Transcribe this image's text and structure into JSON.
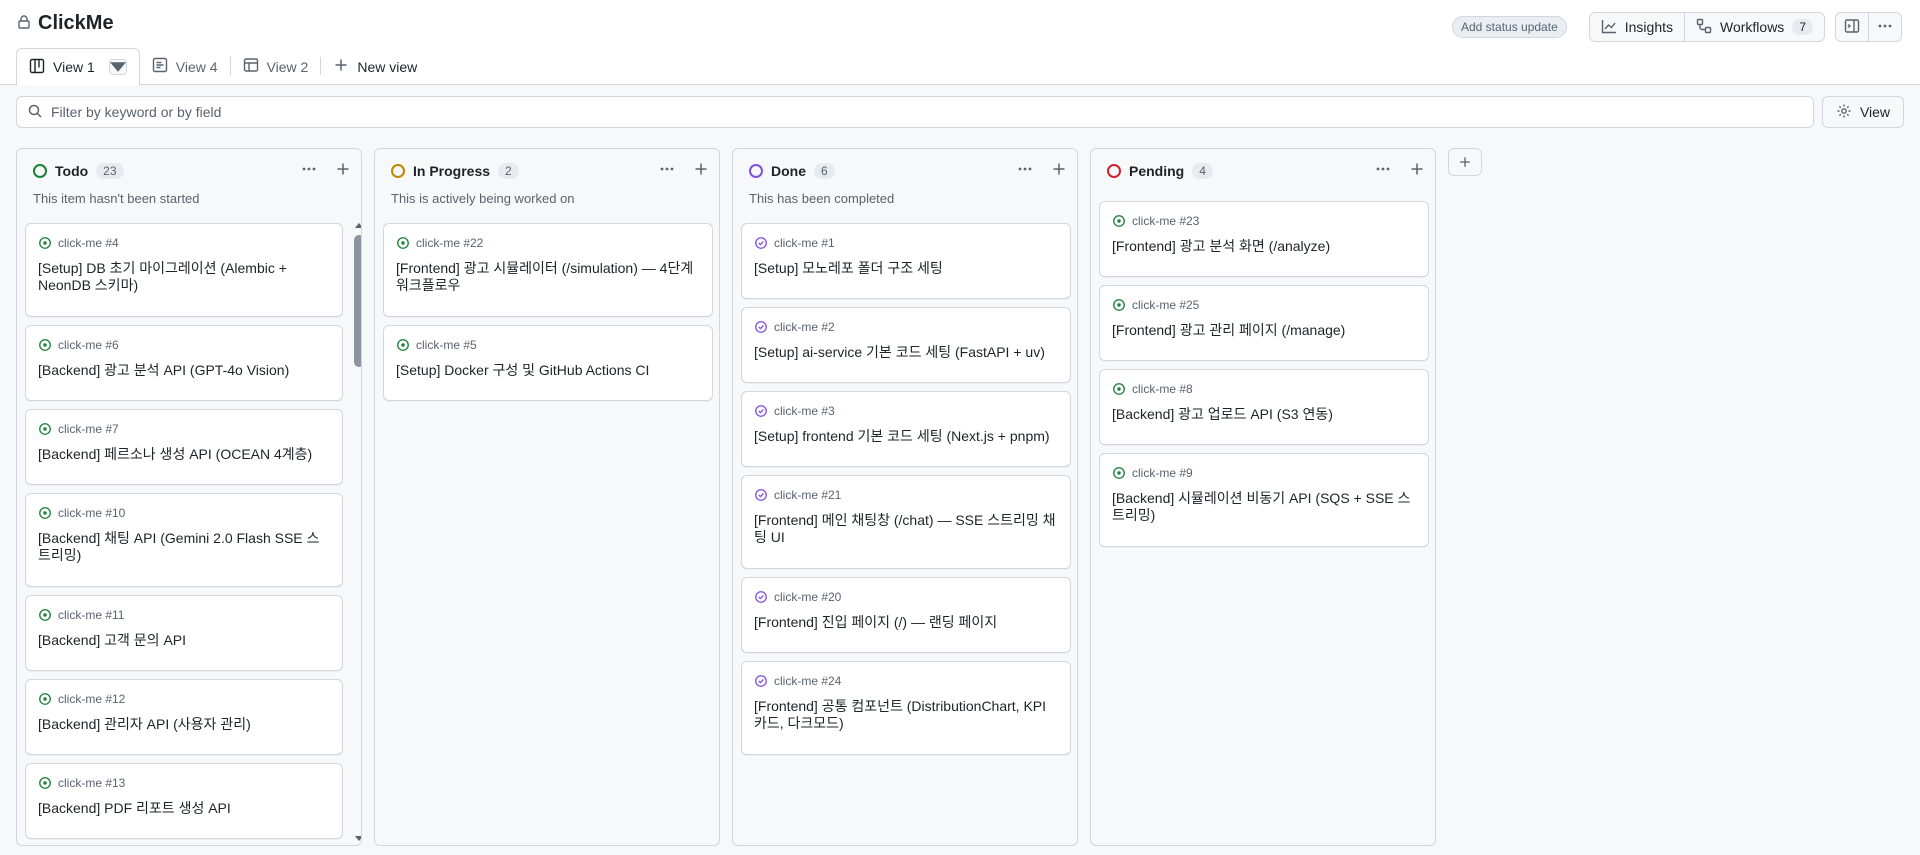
{
  "app": {
    "title": "ClickMe",
    "add_status_update": "Add status update",
    "insights_label": "Insights",
    "workflows_label": "Workflows",
    "workflows_count": "7"
  },
  "tabs": [
    {
      "label": "View 1",
      "icon": "board-icon",
      "active": true
    },
    {
      "label": "View 4",
      "icon": "roadmap-icon",
      "active": false
    },
    {
      "label": "View 2",
      "icon": "table-icon",
      "active": false
    },
    {
      "label": "New view",
      "icon": "plus-icon",
      "active": false
    }
  ],
  "filter": {
    "placeholder": "Filter by keyword or by field",
    "view_button_label": "View"
  },
  "colors": {
    "todo": "#1a7f37",
    "in_progress": "#bf8700",
    "done": "#8250df",
    "pending": "#cf222e"
  },
  "columns": [
    {
      "id": "todo",
      "title": "Todo",
      "count": "23",
      "description": "This item hasn't been started",
      "cards": [
        {
          "ref": "click-me #4",
          "title": "[Setup] DB 초기 마이그레이션 (Alembic + NeonDB 스키마)"
        },
        {
          "ref": "click-me #6",
          "title": "[Backend] 광고 분석 API (GPT-4o Vision)"
        },
        {
          "ref": "click-me #7",
          "title": "[Backend] 페르소나 생성 API (OCEAN 4계층)"
        },
        {
          "ref": "click-me #10",
          "title": "[Backend] 채팅 API (Gemini 2.0 Flash SSE 스트리밍)"
        },
        {
          "ref": "click-me #11",
          "title": "[Backend] 고객 문의 API"
        },
        {
          "ref": "click-me #12",
          "title": "[Backend] 관리자 API (사용자 관리)"
        },
        {
          "ref": "click-me #13",
          "title": "[Backend] PDF 리포트 생성 API"
        }
      ]
    },
    {
      "id": "in_progress",
      "title": "In Progress",
      "count": "2",
      "description": "This is actively being worked on",
      "cards": [
        {
          "ref": "click-me #22",
          "title": "[Frontend] 광고 시뮬레이터 (/simulation) — 4단계 워크플로우"
        },
        {
          "ref": "click-me #5",
          "title": "[Setup] Docker 구성 및 GitHub Actions CI"
        }
      ]
    },
    {
      "id": "done",
      "title": "Done",
      "count": "6",
      "description": "This has been completed",
      "cards": [
        {
          "ref": "click-me #1",
          "title": "[Setup] 모노레포 폴더 구조 세팅"
        },
        {
          "ref": "click-me #2",
          "title": "[Setup] ai-service 기본 코드 세팅 (FastAPI + uv)"
        },
        {
          "ref": "click-me #3",
          "title": "[Setup] frontend 기본 코드 세팅 (Next.js + pnpm)"
        },
        {
          "ref": "click-me #21",
          "title": "[Frontend] 메인 채팅창 (/chat) — SSE 스트리밍 채팅 UI"
        },
        {
          "ref": "click-me #20",
          "title": "[Frontend] 진입 페이지 (/) — 랜딩 페이지"
        },
        {
          "ref": "click-me #24",
          "title": "[Frontend] 공통 컴포넌트 (DistributionChart, KPI 카드, 다크모드)"
        }
      ]
    },
    {
      "id": "pending",
      "title": "Pending",
      "count": "4",
      "description": "",
      "cards": [
        {
          "ref": "click-me #23",
          "title": "[Frontend] 광고 분석 화면 (/analyze)"
        },
        {
          "ref": "click-me #25",
          "title": "[Frontend] 광고 관리 페이지 (/manage)"
        },
        {
          "ref": "click-me #8",
          "title": "[Backend] 광고 업로드 API (S3 연동)"
        },
        {
          "ref": "click-me #9",
          "title": "[Backend] 시뮬레이션 비동기 API (SQS + SSE 스트리밍)"
        }
      ]
    }
  ]
}
